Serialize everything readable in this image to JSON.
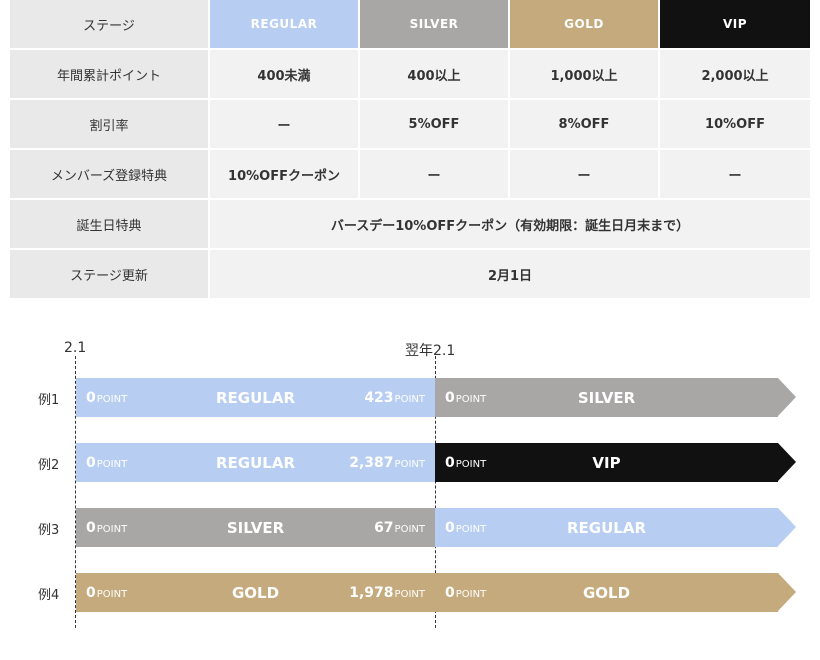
{
  "table": {
    "header": {
      "label": "ステージ",
      "tiers": [
        "REGULAR",
        "SILVER",
        "GOLD",
        "VIP"
      ]
    },
    "rows": [
      {
        "label": "年間累計ポイント",
        "values": [
          "400未満",
          "400以上",
          "1,000以上",
          "2,000以上"
        ]
      },
      {
        "label": "割引率",
        "values": [
          "ー",
          "5%OFF",
          "8%OFF",
          "10%OFF"
        ]
      },
      {
        "label": "メンバーズ登録特典",
        "values": [
          "10%OFFクーポン",
          "ー",
          "ー",
          "ー"
        ]
      },
      {
        "label": "誕生日特典",
        "span": "バースデー10%OFFクーポン（有効期限：誕生日月末まで）"
      },
      {
        "label": "ステージ更新",
        "span": "2月1日"
      }
    ]
  },
  "timeline": {
    "start_label": "2.1",
    "end_label": "翌年2.1",
    "unit": "POINT",
    "examples": [
      {
        "label": "例1",
        "start": "0",
        "stage": "REGULAR",
        "end": "423",
        "next_start": "0",
        "next_stage": "SILVER"
      },
      {
        "label": "例2",
        "start": "0",
        "stage": "REGULAR",
        "end": "2,387",
        "next_start": "0",
        "next_stage": "VIP"
      },
      {
        "label": "例3",
        "start": "0",
        "stage": "SILVER",
        "end": "67",
        "next_start": "0",
        "next_stage": "REGULAR"
      },
      {
        "label": "例4",
        "start": "0",
        "stage": "GOLD",
        "end": "1,978",
        "next_start": "0",
        "next_stage": "GOLD"
      }
    ]
  },
  "colors": {
    "regular": "#b7cdf1",
    "silver": "#a9a6a6",
    "gold": "#c4aa7c",
    "vip": "#111111"
  }
}
